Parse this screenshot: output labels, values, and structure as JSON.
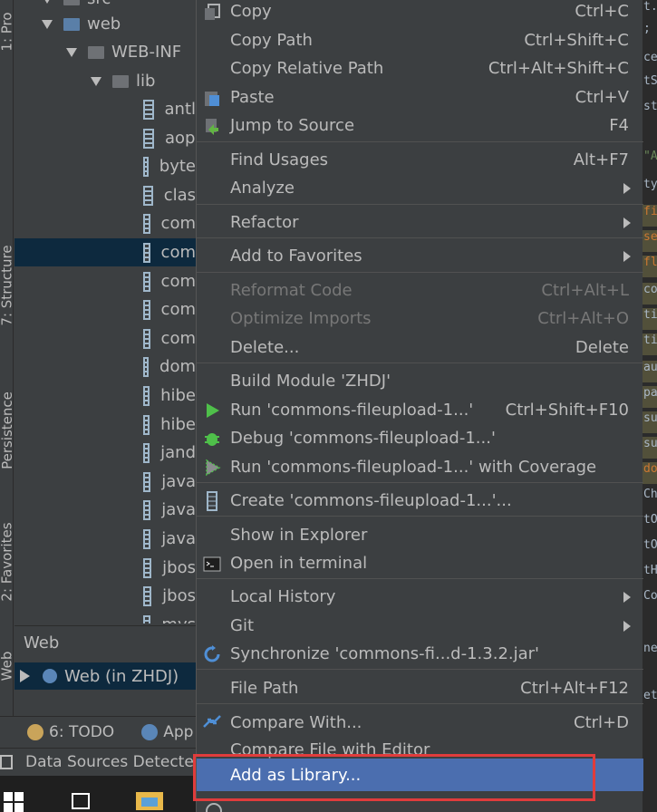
{
  "strip": {
    "tab1": "1: Pro",
    "structure": "7: Structure",
    "persistence": "Persistence",
    "favorites": "2: Favorites",
    "web": "Web"
  },
  "tree": {
    "partial_top": "src",
    "web": "web",
    "webinf": "WEB-INF",
    "lib": "lib",
    "jars": [
      "antl",
      "aop",
      "byte",
      "clas",
      "com",
      "com",
      "com",
      "com",
      "com",
      "dom",
      "hibe",
      "hibe",
      "jand",
      "java",
      "java",
      "java",
      "jbos",
      "jbos",
      "mys"
    ]
  },
  "webpanel": {
    "header": "Web",
    "item": "Web (in ZHDJ)"
  },
  "toolbar": {
    "todo": "6: TODO",
    "app": "App"
  },
  "status": {
    "text": "Data Sources Detecte"
  },
  "menu": {
    "copy": {
      "label": "Copy",
      "shortcut": "Ctrl+C"
    },
    "copy_path": {
      "label": "Copy Path",
      "shortcut": "Ctrl+Shift+C"
    },
    "copy_relative": {
      "label": "Copy Relative Path",
      "shortcut": "Ctrl+Alt+Shift+C"
    },
    "paste": {
      "label": "Paste",
      "shortcut": "Ctrl+V"
    },
    "jump": {
      "label": "Jump to Source",
      "shortcut": "F4"
    },
    "find_usages": {
      "label": "Find Usages",
      "shortcut": "Alt+F7"
    },
    "analyze": {
      "label": "Analyze"
    },
    "refactor": {
      "label": "Refactor"
    },
    "favorites": {
      "label": "Add to Favorites"
    },
    "reformat": {
      "label": "Reformat Code",
      "shortcut": "Ctrl+Alt+L"
    },
    "optimize": {
      "label": "Optimize Imports",
      "shortcut": "Ctrl+Alt+O"
    },
    "delete": {
      "label": "Delete...",
      "shortcut": "Delete"
    },
    "build": {
      "label": "Build Module 'ZHDJ'"
    },
    "run": {
      "label": "Run 'commons-fileupload-1...'",
      "shortcut": "Ctrl+Shift+F10"
    },
    "debug": {
      "label": "Debug 'commons-fileupload-1...'"
    },
    "coverage": {
      "label": "Run 'commons-fileupload-1...' with Coverage"
    },
    "create": {
      "label": "Create 'commons-fileupload-1...'..."
    },
    "explorer": {
      "label": "Show in Explorer"
    },
    "terminal": {
      "label": "Open in terminal"
    },
    "history": {
      "label": "Local History"
    },
    "git": {
      "label": "Git"
    },
    "sync": {
      "label": "Synchronize 'commons-fi...d-1.3.2.jar'"
    },
    "filepath": {
      "label": "File Path",
      "shortcut": "Ctrl+Alt+F12"
    },
    "compare": {
      "label": "Compare With...",
      "shortcut": "Ctrl+D"
    },
    "compare_editor": {
      "label": "Compare File with Editor"
    },
    "add_library": {
      "label": "Add as Library..."
    }
  },
  "editor_lines": [
    "t.",
    ";",
    "ce",
    "tS",
    "st",
    "\"A",
    "ty",
    "fi",
    "se",
    "fl",
    "co",
    "ti",
    "ti",
    "au",
    "pa",
    "su",
    "su",
    "do",
    "Ch",
    "tO",
    "tO",
    "tH",
    "Co",
    "ne",
    "et"
  ],
  "colors": {
    "menu_bg": "#3c3f41",
    "highlight": "#4b6eaf",
    "annotation_box": "#e03c3c",
    "selection": "#0d293e"
  }
}
